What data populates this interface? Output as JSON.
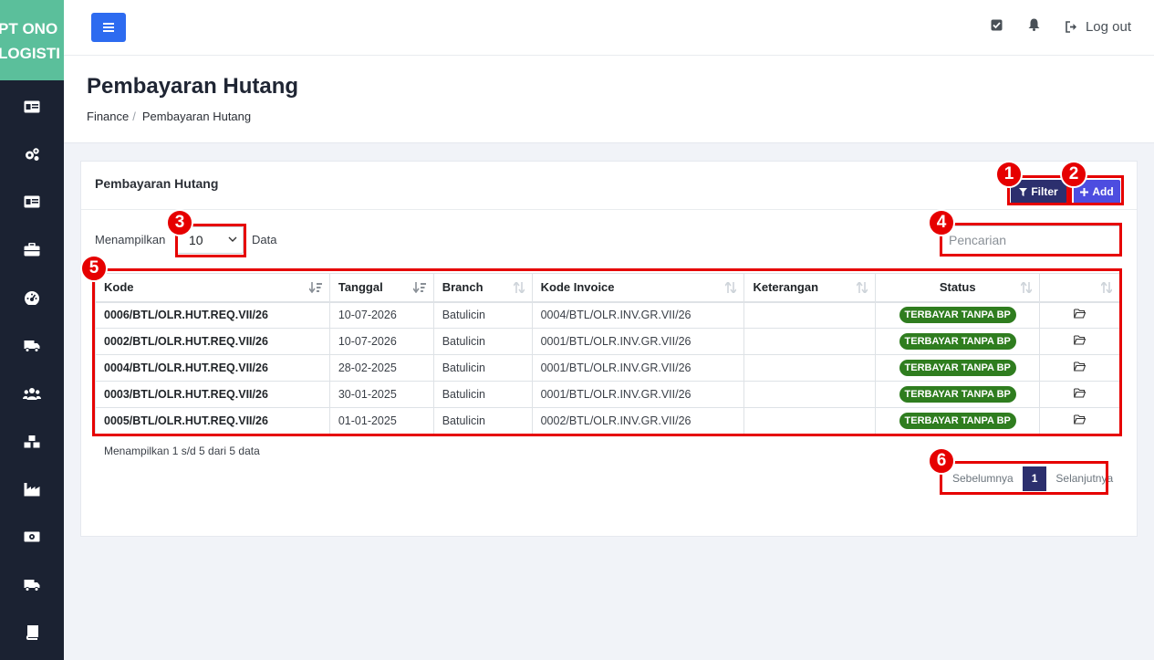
{
  "brand": {
    "line1": "PT ONO",
    "line2": "LOGISTI"
  },
  "sidebar": {
    "items": [
      {
        "icon": "id-card-icon"
      },
      {
        "icon": "gears-icon"
      },
      {
        "icon": "id-card-alt-icon"
      },
      {
        "icon": "briefcase-icon"
      },
      {
        "icon": "dashboard-gauge-icon"
      },
      {
        "icon": "truck-icon"
      },
      {
        "icon": "users-icon"
      },
      {
        "icon": "cubes-icon"
      },
      {
        "icon": "industry-icon"
      },
      {
        "icon": "money-bill-icon"
      },
      {
        "icon": "truck-icon"
      },
      {
        "icon": "book-icon"
      }
    ]
  },
  "topbar": {
    "logout_label": "Log out"
  },
  "page": {
    "title": "Pembayaran Hutang",
    "breadcrumb": {
      "parent": "Finance",
      "separator": "/",
      "current": "Pembayaran Hutang"
    }
  },
  "card": {
    "title": "Pembayaran Hutang",
    "filter_label": "Filter",
    "add_label": "Add",
    "show_label": "Menampilkan",
    "page_size": "10",
    "data_label": "Data",
    "search_placeholder": "Pencarian",
    "columns": [
      "Kode",
      "Tanggal",
      "Branch",
      "Kode Invoice",
      "Keterangan",
      "Status",
      ""
    ],
    "rows": [
      {
        "kode": "0006/BTL/OLR.HUT.REQ.VII/26",
        "tanggal": "10-07-2026",
        "branch": "Batulicin",
        "invoice": "0004/BTL/OLR.INV.GR.VII/26",
        "keterangan": "",
        "status": "TERBAYAR TANPA BP"
      },
      {
        "kode": "0002/BTL/OLR.HUT.REQ.VII/26",
        "tanggal": "10-07-2026",
        "branch": "Batulicin",
        "invoice": "0001/BTL/OLR.INV.GR.VII/26",
        "keterangan": "",
        "status": "TERBAYAR TANPA BP"
      },
      {
        "kode": "0004/BTL/OLR.HUT.REQ.VII/26",
        "tanggal": "28-02-2025",
        "branch": "Batulicin",
        "invoice": "0001/BTL/OLR.INV.GR.VII/26",
        "keterangan": "",
        "status": "TERBAYAR TANPA BP"
      },
      {
        "kode": "0003/BTL/OLR.HUT.REQ.VII/26",
        "tanggal": "30-01-2025",
        "branch": "Batulicin",
        "invoice": "0001/BTL/OLR.INV.GR.VII/26",
        "keterangan": "",
        "status": "TERBAYAR TANPA BP"
      },
      {
        "kode": "0005/BTL/OLR.HUT.REQ.VII/26",
        "tanggal": "01-01-2025",
        "branch": "Batulicin",
        "invoice": "0002/BTL/OLR.INV.GR.VII/26",
        "keterangan": "",
        "status": "TERBAYAR TANPA BP"
      }
    ],
    "info": "Menampilkan 1 s/d 5 dari 5 data",
    "pager": {
      "prev": "Sebelumnya",
      "current": "1",
      "next": "Selanjutnya"
    }
  },
  "annotations": [
    "1",
    "2",
    "3",
    "4",
    "5",
    "6"
  ],
  "colors": {
    "sidebar": "#1b2232",
    "brand": "#5bbf9b",
    "primary": "#2d6bf0",
    "filter": "#2c2f6e",
    "add": "#4d4de0",
    "badge": "#2f7d1f",
    "annotation": "#e60000"
  }
}
